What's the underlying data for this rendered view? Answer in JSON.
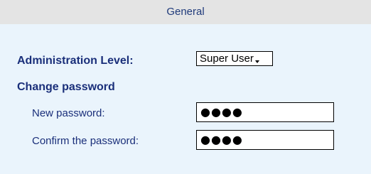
{
  "header": {
    "title": "General"
  },
  "form": {
    "admin_level_label": "Administration Level:",
    "admin_level_value": "Super User",
    "change_password_heading": "Change password",
    "new_password_label": "New password:",
    "new_password_value": "●●●●",
    "confirm_password_label": "Confirm the password:",
    "confirm_password_value": "●●●●"
  },
  "colors": {
    "header_background": "#e4e4e4",
    "body_background": "#eaf4fc",
    "text_blue": "#1a2f7a"
  }
}
